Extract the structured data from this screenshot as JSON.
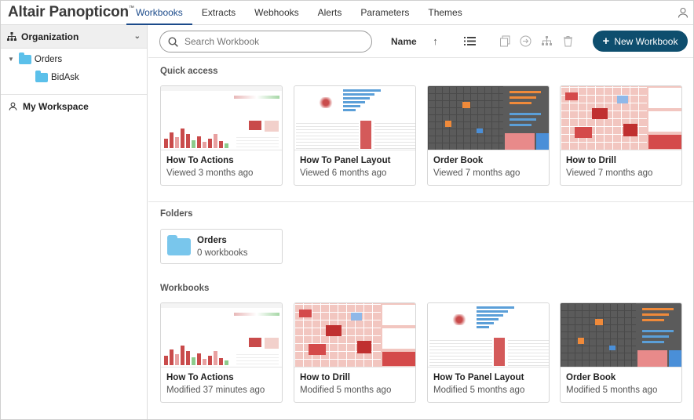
{
  "app": {
    "title": "Altair Panopticon",
    "tm": "™"
  },
  "tabs": [
    "Workbooks",
    "Extracts",
    "Webhooks",
    "Alerts",
    "Parameters",
    "Themes"
  ],
  "sidebar": {
    "organization": "Organization",
    "folders": [
      {
        "label": "Orders"
      },
      {
        "label": "BidAsk"
      }
    ],
    "workspace": "My Workspace"
  },
  "toolbar": {
    "search_placeholder": "Search Workbook",
    "sort_label": "Name",
    "new_button": "New Workbook"
  },
  "sections": {
    "quick": "Quick access",
    "folders": "Folders",
    "workbooks": "Workbooks"
  },
  "quick_access": [
    {
      "title": "How To Actions",
      "sub": "Viewed 3 months ago"
    },
    {
      "title": "How To Panel Layout",
      "sub": "Viewed 6 months ago"
    },
    {
      "title": "Order Book",
      "sub": "Viewed 7 months ago"
    },
    {
      "title": "How to Drill",
      "sub": "Viewed 7 months ago"
    }
  ],
  "folder": {
    "name": "Orders",
    "count": "0 workbooks"
  },
  "workbooks": [
    {
      "title": "How To Actions",
      "sub": "Modified 37 minutes ago"
    },
    {
      "title": "How to Drill",
      "sub": "Modified 5 months ago"
    },
    {
      "title": "How To Panel Layout",
      "sub": "Modified 5 months ago"
    },
    {
      "title": "Order Book",
      "sub": "Modified 5 months ago"
    }
  ],
  "colors": {
    "accent": "#1b4a8a",
    "button": "#0e4e6e",
    "folder": "#5bc0ea"
  }
}
